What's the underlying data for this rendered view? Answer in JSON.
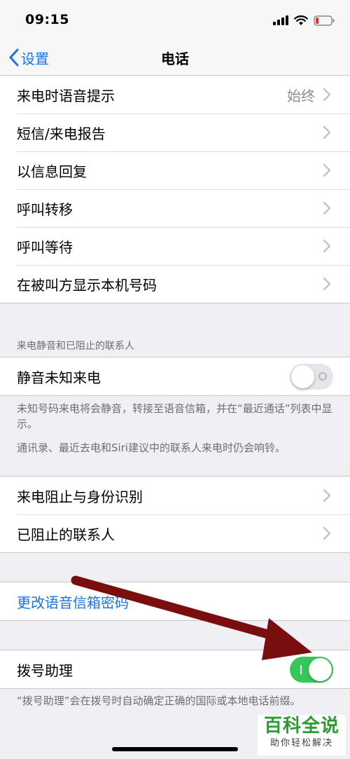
{
  "status": {
    "time": "09:15"
  },
  "nav": {
    "back_label": "设置",
    "title": "电话"
  },
  "group1": [
    {
      "label": "来电时语音提示",
      "value": "始终"
    },
    {
      "label": "短信/来电报告"
    },
    {
      "label": "以信息回复"
    },
    {
      "label": "呼叫转移"
    },
    {
      "label": "呼叫等待"
    },
    {
      "label": "在被叫方显示本机号码"
    }
  ],
  "silence": {
    "header": "来电静音和已阻止的联系人",
    "row_label": "静音未知来电",
    "enabled": false,
    "footer1": "未知号码来电将会静音，转接至语音信箱，并在“最近通话”列表中显示。",
    "footer2": "通讯录、最近去电和Siri建议中的联系人来电时仍会响铃。"
  },
  "group3": [
    {
      "label": "来电阻止与身份识别"
    },
    {
      "label": "已阻止的联系人"
    }
  ],
  "voicemail": {
    "label": "更改语音信箱密码"
  },
  "dial_assist": {
    "label": "拨号助理",
    "enabled": true,
    "footer": "“拨号助理”会在拨号时自动确定正确的国际或本地电话前缀。"
  },
  "watermark": {
    "main": "百科全说",
    "sub": "助你轻松解决"
  },
  "colors": {
    "accent": "#1a73e8",
    "toggle_on": "#34c759",
    "arrow": "#7a0e0e"
  }
}
